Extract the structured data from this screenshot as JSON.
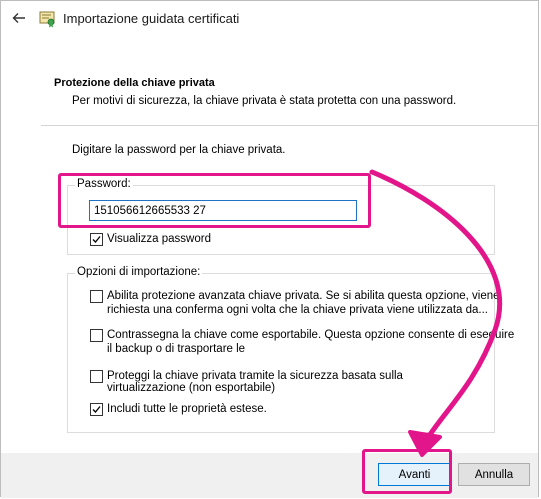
{
  "window": {
    "title": "Importazione guidata certificati"
  },
  "section": {
    "title": "Protezione della chiave privata",
    "subtitle": "Per motivi di sicurezza, la chiave privata è stata protetta con una password."
  },
  "prompt": "Digitare la password per la chiave privata.",
  "password_group": {
    "label": "Password:",
    "value": "151056612665533 27",
    "show_password_label": "Visualizza password",
    "show_password_checked": true
  },
  "options_group": {
    "label": "Opzioni di importazione:",
    "options": [
      {
        "label_line1": "Abilita protezione avanzata chiave privata. Se si abilita questa opzione, viene",
        "label_line2": "richiesta una conferma ogni volta che la chiave privata viene utilizzata da...",
        "checked": false
      },
      {
        "label_line1": "Contrassegna la chiave come esportabile. Questa opzione consente di eseguire",
        "label_line2": "il backup o di trasportare le",
        "checked": false
      },
      {
        "label_line1": "Proteggi la chiave privata tramite la sicurezza basata sulla",
        "label_line2": "virtualizzazione (non esportabile)",
        "checked": false
      },
      {
        "label_line1": "Includi tutte le proprietà estese.",
        "label_line2": "",
        "checked": true
      }
    ]
  },
  "buttons": {
    "next": "Avanti",
    "cancel": "Annulla"
  },
  "colors": {
    "highlight": "#e2168a",
    "focus_border": "#0078d7"
  }
}
